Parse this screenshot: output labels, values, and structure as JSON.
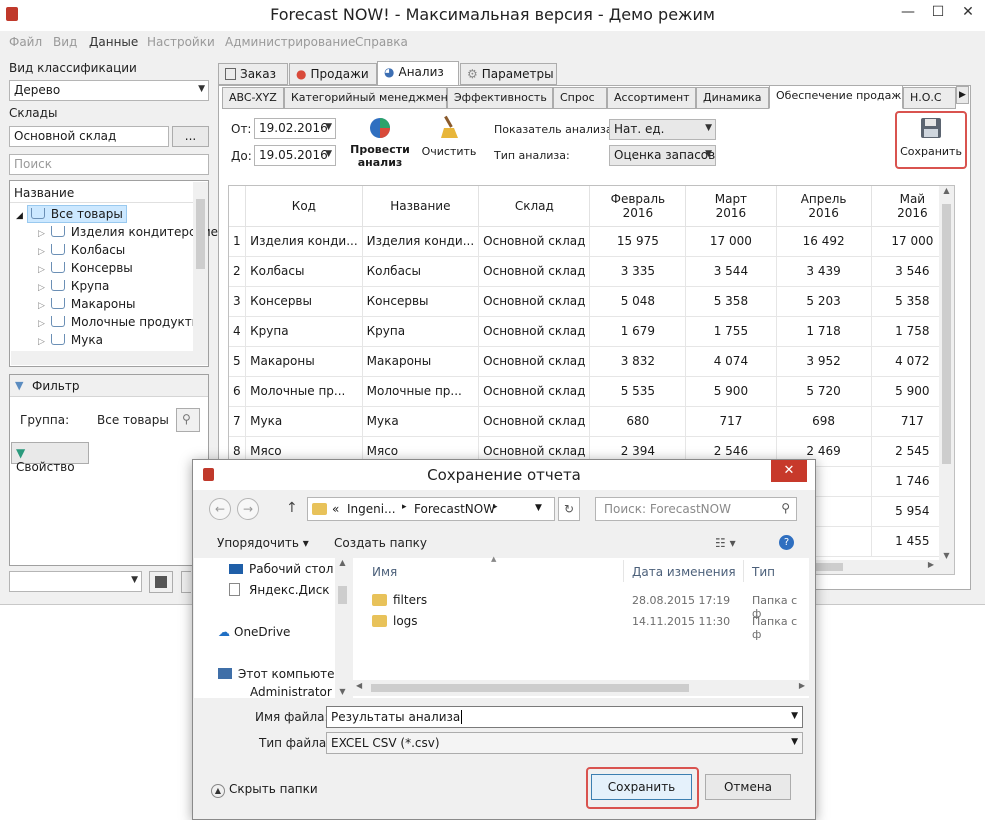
{
  "window": {
    "title": "Forecast NOW! - Максимальная версия - Демо режим",
    "minimize": "—",
    "maximize": "☐",
    "close": "✕"
  },
  "menu": [
    {
      "label": "Файл",
      "enabled": false
    },
    {
      "label": "Вид",
      "enabled": false
    },
    {
      "label": "Данные",
      "enabled": true
    },
    {
      "label": "Настройки",
      "enabled": false
    },
    {
      "label": "Администрирование",
      "enabled": false
    },
    {
      "label": "Справка",
      "enabled": false
    }
  ],
  "left": {
    "classification_label": "Вид классификации",
    "classification_value": "Дерево",
    "warehouses_label": "Склады",
    "warehouse_value": "Основной склад",
    "browse_button": "...",
    "search_placeholder": "Поиск",
    "tree_header": "Название",
    "tree_items": [
      "Все товары",
      "Изделия кондитерские",
      "Колбасы",
      "Консервы",
      "Крупа",
      "Макароны",
      "Молочные продукты",
      "Мука"
    ],
    "filter_title": "Фильтр",
    "group_label": "Группа:",
    "group_value": "Все товары",
    "property_button": "Свойство"
  },
  "main_tabs": [
    "Заказ",
    "Продажи",
    "Анализ",
    "Параметры"
  ],
  "sub_tabs": [
    "ABC-XYZ",
    "Категорийный менеджмент",
    "Эффективность",
    "Спрос",
    "Ассортимент",
    "Динамика",
    "Обеспечение продаж",
    "Н.О.С"
  ],
  "toolbar": {
    "from_label": "От:",
    "from_date": "19.02.2016",
    "to_label": "До:",
    "to_date": "19.05.2016",
    "run_label": "Провести анализ",
    "clear_label": "Очистить",
    "indicator_label": "Показатель анализа:",
    "indicator_value": "Нат. ед.",
    "type_label": "Тип анализа:",
    "type_value": "Оценка запасов",
    "save_label": "Сохранить"
  },
  "table": {
    "headers": [
      "Код",
      "Название",
      "Склад",
      "Февраль 2016",
      "Март 2016",
      "Апрель 2016",
      "Май 2016"
    ],
    "rows": [
      [
        "1",
        "Изделия конди...",
        "Изделия конди...",
        "Основной склад",
        "15 975",
        "17 000",
        "16 492",
        "17 000"
      ],
      [
        "2",
        "Колбасы",
        "Колбасы",
        "Основной склад",
        "3 335",
        "3 544",
        "3 439",
        "3 546"
      ],
      [
        "3",
        "Консервы",
        "Консервы",
        "Основной склад",
        "5 048",
        "5 358",
        "5 203",
        "5 358"
      ],
      [
        "4",
        "Крупа",
        "Крупа",
        "Основной склад",
        "1 679",
        "1 755",
        "1 718",
        "1 758"
      ],
      [
        "5",
        "Макароны",
        "Макароны",
        "Основной склад",
        "3 832",
        "4 074",
        "3 952",
        "4 072"
      ],
      [
        "6",
        "Молочные пр...",
        "Молочные пр...",
        "Основной склад",
        "5 535",
        "5 900",
        "5 720",
        "5 900"
      ],
      [
        "7",
        "Мука",
        "Мука",
        "Основной склад",
        "680",
        "717",
        "698",
        "717"
      ],
      [
        "8",
        "Мясо",
        "Мясо",
        "Основной склад",
        "2 394",
        "2 546",
        "2 469",
        "2 545"
      ]
    ],
    "extra_values": [
      "1 746",
      "5 954",
      "1 455"
    ]
  },
  "dialog": {
    "title": "Сохранение отчета",
    "path": [
      "«",
      "Ingeni...",
      "▸",
      "ForecastNOW",
      "▸"
    ],
    "search_placeholder": "Поиск: ForecastNOW",
    "organize": "Упорядочить ▾",
    "new_folder": "Создать папку",
    "nav_items": [
      "Рабочий стол",
      "Яндекс.Диск",
      "OneDrive",
      "Этот компьютер",
      "Administrator (i"
    ],
    "columns": [
      "Имя",
      "Дата изменения",
      "Тип"
    ],
    "files": [
      {
        "name": "filters",
        "date": "28.08.2015 17:19",
        "type": "Папка с ф"
      },
      {
        "name": "logs",
        "date": "14.11.2015 11:30",
        "type": "Папка с ф"
      }
    ],
    "filename_label": "Имя файла:",
    "filename_value": "Результаты анализа",
    "filetype_label": "Тип файла:",
    "filetype_value": "EXCEL CSV (*.csv)",
    "hide_folders": "Скрыть папки",
    "save_button": "Сохранить",
    "cancel_button": "Отмена"
  },
  "colors": {
    "highlight_red": "#d9534f",
    "folder": "#e8c25a",
    "selection": "#cce8ff"
  }
}
